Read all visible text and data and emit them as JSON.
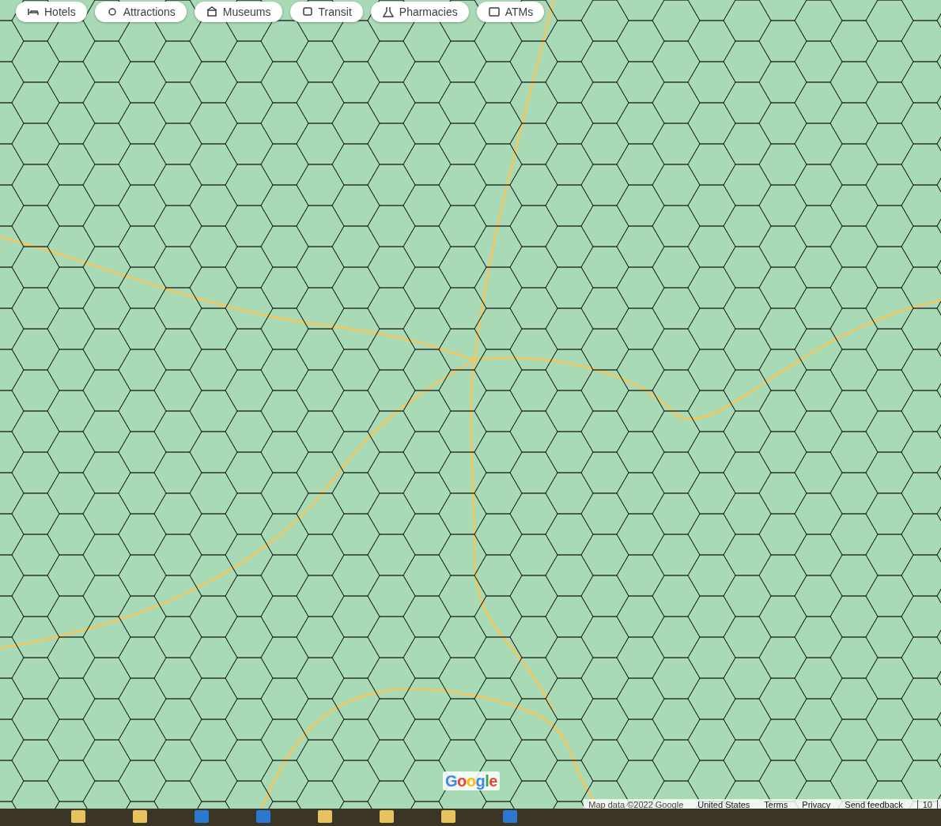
{
  "filter_chips": [
    {
      "label": "Hotels"
    },
    {
      "label": "Attractions"
    },
    {
      "label": "Museums"
    },
    {
      "label": "Transit"
    },
    {
      "label": "Pharmacies"
    },
    {
      "label": "ATMs"
    }
  ],
  "map": {
    "logo": "Google"
  },
  "attribution": [
    {
      "kind": "text",
      "label": "Map data ©2022 Google"
    },
    {
      "kind": "link",
      "label": "United States"
    },
    {
      "kind": "link",
      "label": "Terms"
    },
    {
      "kind": "link",
      "label": "Privacy"
    },
    {
      "kind": "link",
      "label": "Send feedback"
    },
    {
      "kind": "scale",
      "label": "10"
    }
  ]
}
